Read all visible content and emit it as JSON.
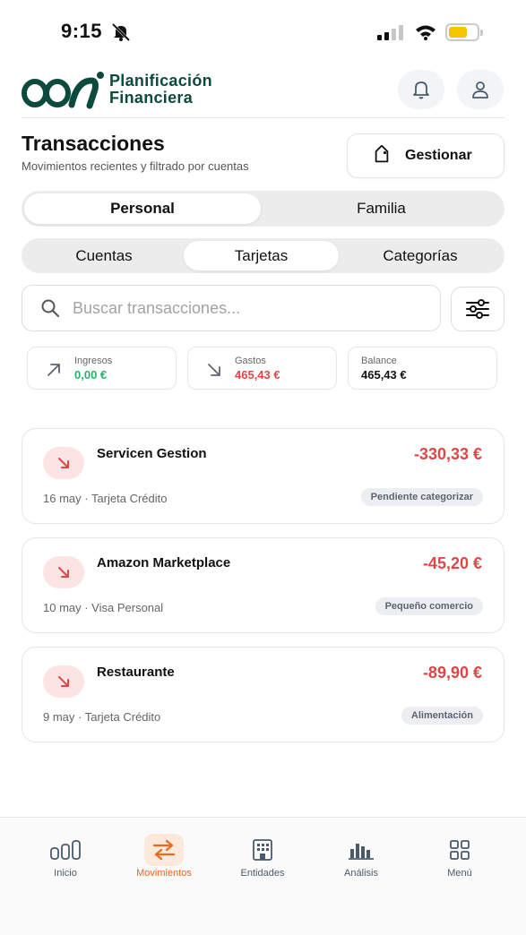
{
  "status_bar": {
    "time": "9:15"
  },
  "header": {
    "brand_line1": "Planificación",
    "brand_line2": "Financiera"
  },
  "page": {
    "title": "Transacciones",
    "subtitle": "Movimientos recientes y filtrado por cuentas",
    "manage_label": "Gestionar"
  },
  "scope_tabs": [
    "Personal",
    "Familia"
  ],
  "view_tabs": [
    "Cuentas",
    "Tarjetas",
    "Categorías"
  ],
  "search": {
    "placeholder": "Buscar transacciones..."
  },
  "summary": {
    "income": {
      "label": "Ingresos",
      "value": "0,00 €",
      "color": "#1fb46a"
    },
    "expenses": {
      "label": "Gastos",
      "value": "465,43 €",
      "color": "#e04646"
    },
    "balance": {
      "label": "Balance",
      "value": "465,43 €"
    }
  },
  "transactions": [
    {
      "name": "Servicen Gestion",
      "amount": "-330,33 €",
      "meta": "16 may · Tarjeta Crédito",
      "category": "Pendiente categorizar"
    },
    {
      "name": "Amazon Marketplace",
      "amount": "-45,20 €",
      "meta": "10 may · Visa Personal",
      "category": "Pequeño comercio"
    },
    {
      "name": "Restaurante",
      "amount": "-89,90 €",
      "meta": "9 may · Tarjeta Crédito",
      "category": "Alimentación"
    }
  ],
  "bottom_nav": [
    {
      "label": "Inicio",
      "icon": "bars-icon"
    },
    {
      "label": "Movimientos",
      "icon": "swap-arrows-icon",
      "active": true
    },
    {
      "label": "Entidades",
      "icon": "building-icon"
    },
    {
      "label": "Análisis",
      "icon": "chart-icon"
    },
    {
      "label": "Menú",
      "icon": "grid-icon"
    }
  ],
  "colors": {
    "brand": "#0d4a3e",
    "accent": "#e86a1c",
    "negative": "#e04646",
    "positive": "#1fb46a"
  }
}
